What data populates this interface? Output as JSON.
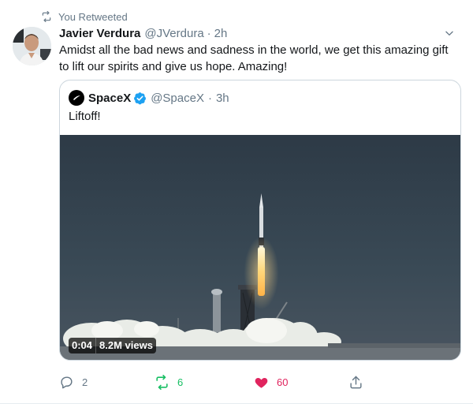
{
  "retweet_context": {
    "label": "You Retweeted"
  },
  "tweet": {
    "author_name": "Javier Verdura",
    "author_handle": "@JVerdura",
    "separator": "·",
    "time": "2h",
    "text": "Amidst all the bad news and sadness in the world, we get this amazing gift to lift our spirits and give us hope. Amazing!"
  },
  "quoted_tweet": {
    "author_name": "SpaceX",
    "author_handle": "@SpaceX",
    "separator": "·",
    "time": "3h",
    "text": "Liftoff!",
    "video": {
      "duration": "0:04",
      "views": "8.2M views"
    }
  },
  "actions": {
    "reply_count": "2",
    "retweet_count": "6",
    "like_count": "60"
  },
  "colors": {
    "retweet_active": "#17bf63",
    "like_active": "#e0245e",
    "secondary_text": "#657786",
    "verified": "#1da1f2"
  },
  "icons": [
    "retweet-icon",
    "caret-down-icon",
    "spacex-logo-icon",
    "verified-badge-icon",
    "reply-icon",
    "heart-icon",
    "share-icon"
  ]
}
